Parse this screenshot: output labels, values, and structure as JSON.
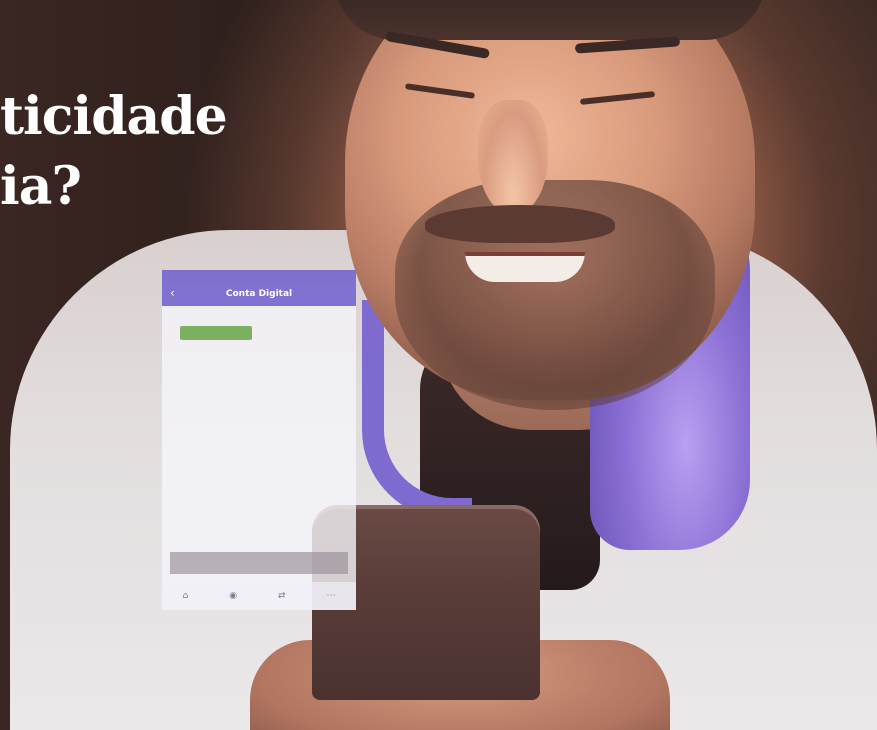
{
  "headline": {
    "line1": "ticidade",
    "line2": "ia?"
  },
  "app": {
    "status": {
      "left": "",
      "center": "",
      "right": ""
    },
    "nav": {
      "title": "Conta Digital"
    },
    "body": {
      "paragraph1": "",
      "paragraph2": "",
      "question": ""
    },
    "primary_button": "",
    "info_text": "",
    "link_text": "",
    "cta_button": "",
    "tabs": [
      {
        "label": "",
        "icon": "home-icon"
      },
      {
        "label": "",
        "icon": "card-icon"
      },
      {
        "label": "",
        "icon": "transfer-icon"
      },
      {
        "label": "",
        "icon": "more-icon"
      }
    ]
  },
  "colors": {
    "app_header": "#7464ce",
    "primary_button": "#6eaa50",
    "headline_text": "#ffffff"
  }
}
